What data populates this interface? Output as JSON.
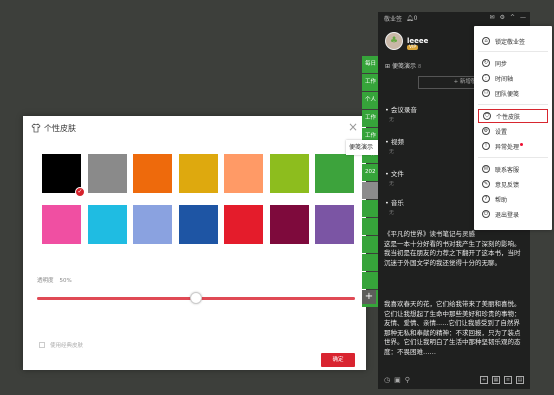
{
  "skin_dialog": {
    "title": "个性皮肤",
    "close_glyph": "×",
    "swatches": [
      {
        "name": "black",
        "color": "#000000",
        "selected": true
      },
      {
        "name": "gray",
        "color": "#8a8a8a"
      },
      {
        "name": "orange",
        "color": "#ee6a0c"
      },
      {
        "name": "amber",
        "color": "#dea90e"
      },
      {
        "name": "salmon",
        "color": "#ff9a66"
      },
      {
        "name": "lime",
        "color": "#8dbd1e"
      },
      {
        "name": "green",
        "color": "#3da33c"
      },
      {
        "name": "pink",
        "color": "#f04fa2"
      },
      {
        "name": "sky",
        "color": "#1fbce2"
      },
      {
        "name": "periwinkle",
        "color": "#8aa2e0"
      },
      {
        "name": "blue",
        "color": "#1e55a4"
      },
      {
        "name": "red",
        "color": "#e41c2b"
      },
      {
        "name": "maroon",
        "color": "#7e0a3c"
      },
      {
        "name": "violet",
        "color": "#7b55a4"
      }
    ],
    "opacity_label": "透明度",
    "opacity_value_text": "50%",
    "opacity_value": 0.5,
    "classic_skin_label": "使用经典皮肤",
    "confirm_label": "确定"
  },
  "side_tabs": {
    "items": [
      "每日",
      "工作",
      "个人",
      "工作",
      "工作",
      "工作",
      "202",
      "",
      "",
      "",
      "",
      "",
      "",
      "工作"
    ],
    "active_label": "便笺演示",
    "add_glyph": "+"
  },
  "app": {
    "title": "敬业签",
    "bell_text": "0",
    "title_controls": [
      "✉",
      "⚙",
      "^",
      "—"
    ],
    "user": {
      "name": "leeee",
      "vip": "VIP"
    },
    "notebook": {
      "name": "便笺演示",
      "count": "8"
    },
    "new_label": "+ 新增敬业签",
    "sections": [
      {
        "title": "会议录音",
        "empty": "无"
      },
      {
        "title": "视频",
        "empty": "无"
      },
      {
        "title": "文件",
        "empty": "无"
      },
      {
        "title": "音乐",
        "empty": "无"
      }
    ],
    "notes": [
      "《平凡的世界》读书笔记与灵感\n这是一本十分好看的书对我产生了深刻的影响。我当初是在朋友的力荐之下翻开了这本书，当时沉迷于外国文学的我还觉得十分的无聊。",
      "我喜欢春天的花，它们给我带来了美丽和喜悦。它们让我想起了生命中那些美好和珍贵的事物：友情、爱情、亲情......它们让我感受到了自然界那种无私和奉献的精神：不求回报，只为了装点世界。它们让我明白了生活中那种坚韧乐观的态度：不畏困难……"
    ]
  },
  "menu": {
    "items": [
      {
        "label": "锁定敬业签",
        "icon": "lock-icon",
        "glyph": "⌂"
      },
      {
        "label": "同步",
        "icon": "sync-icon",
        "glyph": "↻"
      },
      {
        "label": "时间轴",
        "icon": "timeline-icon",
        "glyph": "⋮"
      },
      {
        "label": "团队便笺",
        "icon": "team-icon",
        "glyph": "⚇"
      },
      {
        "label": "个性皮肤",
        "icon": "skin-icon",
        "glyph": "⛉",
        "highlight": true
      },
      {
        "label": "设置",
        "icon": "settings-icon",
        "glyph": "⚙"
      },
      {
        "label": "异常处理",
        "icon": "repair-icon",
        "glyph": "!",
        "dot": true
      },
      {
        "label": "联系客服",
        "icon": "service-icon",
        "glyph": "✉"
      },
      {
        "label": "意见反馈",
        "icon": "feedback-icon",
        "glyph": "✎"
      },
      {
        "label": "帮助",
        "icon": "help-icon",
        "glyph": "?"
      },
      {
        "label": "退出登录",
        "icon": "logout-icon",
        "glyph": "⏻"
      }
    ]
  }
}
